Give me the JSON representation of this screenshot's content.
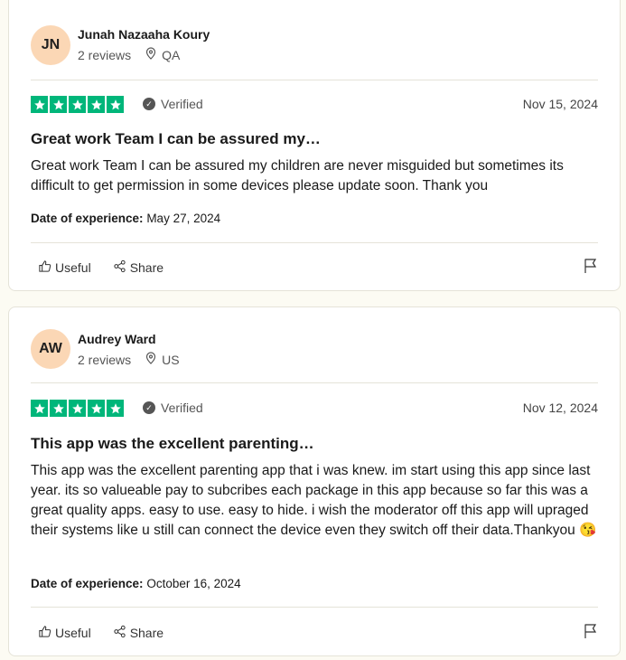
{
  "reviews": [
    {
      "initials": "JN",
      "name": "Junah Nazaaha Koury",
      "review_count": "2 reviews",
      "country": "QA",
      "rating": 5,
      "verified": "Verified",
      "date": "Nov 15, 2024",
      "title": "Great work Team I can be assured my…",
      "text": "Great work Team I can be assured my children are never misguided but sometimes its difficult to get permission in some devices please update soon. Thank you",
      "experience_label": "Date of experience:",
      "experience_date": "May 27, 2024",
      "useful": "Useful",
      "share": "Share"
    },
    {
      "initials": "AW",
      "name": "Audrey Ward",
      "review_count": "2 reviews",
      "country": "US",
      "rating": 5,
      "verified": "Verified",
      "date": "Nov 12, 2024",
      "title": "This app was the excellent parenting…",
      "text": "This app was the excellent parenting app that i was knew. im start using this app since last year. its so valueable pay to subcribes each package in this app because so far this was a great quality apps. easy to use. easy to hide. i wish the moderator off this app will upraged their systems like u still can connect the device even they switch off their data.Thankyou 😘",
      "experience_label": "Date of experience:",
      "experience_date": "October 16, 2024",
      "useful": "Useful",
      "share": "Share"
    }
  ],
  "colors": {
    "star": "#00b67a",
    "avatar": "#fbd7b5"
  },
  "icons": [
    "location-pin-icon",
    "verified-check-icon",
    "star-icon",
    "thumbs-up-icon",
    "share-icon",
    "flag-icon"
  ]
}
